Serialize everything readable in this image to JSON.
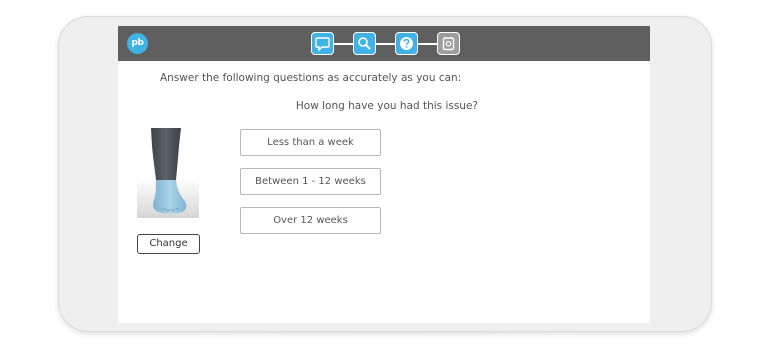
{
  "app": {
    "logo_text": "pb",
    "accent_color": "#40b2e3",
    "topbar_color": "#5f5f5f"
  },
  "steps": [
    {
      "icon": "speech-bubble-icon",
      "state": "active"
    },
    {
      "icon": "magnifier-icon",
      "state": "active"
    },
    {
      "icon": "question-mark-icon",
      "state": "active"
    },
    {
      "icon": "clipboard-icon",
      "state": "inactive"
    }
  ],
  "main": {
    "intro": "Answer the following questions as accurately as you can:",
    "question": "How long have you had this issue?",
    "change_label": "Change",
    "options": [
      {
        "label": "Less than a week"
      },
      {
        "label": "Between 1 - 12 weeks"
      },
      {
        "label": "Over 12 weeks"
      }
    ]
  }
}
